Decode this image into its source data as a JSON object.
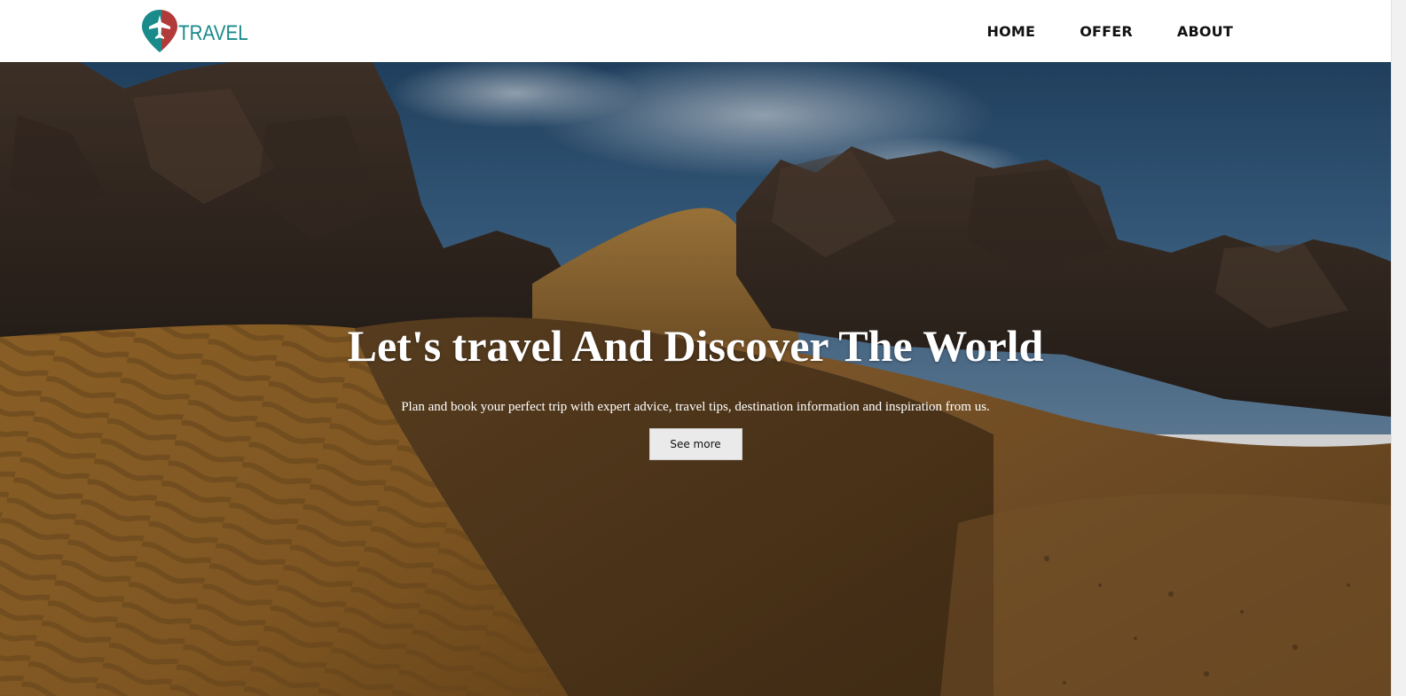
{
  "brand": {
    "name": "TRAVEL",
    "colors": {
      "teal": "#1a8a8a",
      "red": "#b23a3a"
    },
    "icon": "map-pin-airplane-icon"
  },
  "nav": {
    "items": [
      {
        "label": "HOME"
      },
      {
        "label": "OFFER"
      },
      {
        "label": "ABOUT"
      }
    ]
  },
  "hero": {
    "background": "desert-dunes-and-rock-formations-image",
    "title": "Let's travel And Discover The World",
    "subtitle": "Plan and book your perfect trip with expert advice, travel tips, destination information and inspiration from us.",
    "button_label": "See more"
  }
}
